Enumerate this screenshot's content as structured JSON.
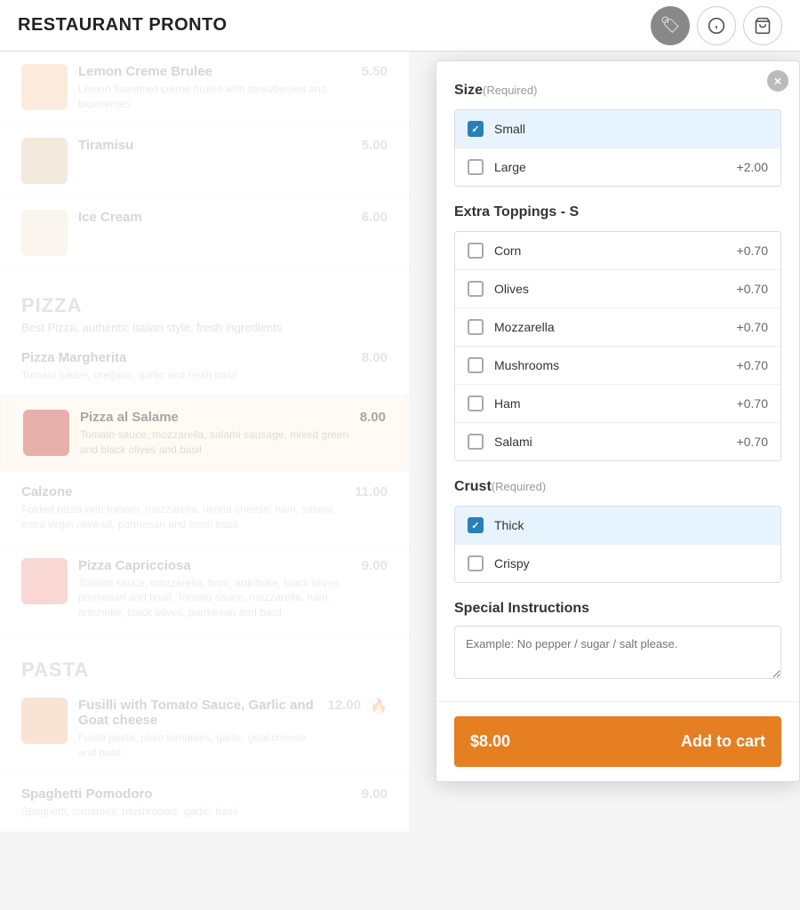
{
  "header": {
    "title": "RESTAURANT PRONTO",
    "icons": [
      {
        "name": "menu-icon",
        "label": "🏷",
        "active": true
      },
      {
        "name": "info-icon",
        "label": "ⓘ",
        "active": false
      },
      {
        "name": "cart-icon",
        "label": "🛒",
        "active": false
      }
    ]
  },
  "menu": {
    "sections": [
      {
        "id": "desserts",
        "title": "",
        "items": [
          {
            "id": "lemon-creme",
            "name": "Lemon Creme Brulee",
            "desc": "Lemon flavoured crème brulee with strawberries and blueberries",
            "price": "5.50",
            "hasImage": true,
            "imgColor": "#f4a460",
            "selected": false,
            "dimmed": true
          },
          {
            "id": "tiramisu",
            "name": "Tiramisu",
            "desc": "",
            "price": "5.00",
            "hasImage": true,
            "imgColor": "#c8a06a",
            "selected": false,
            "dimmed": true
          },
          {
            "id": "ice-cream",
            "name": "Ice Cream",
            "desc": "",
            "price": "6.00",
            "hasImage": true,
            "imgColor": "#e8d5b7",
            "selected": false,
            "dimmed": true
          }
        ]
      },
      {
        "id": "pizza",
        "title": "PIZZA",
        "desc": "Best Pizza, authentic Italian style, fresh ingredients",
        "items": [
          {
            "id": "pizza-margherita",
            "name": "Pizza Margherita",
            "desc": "Tomato sauce, oregano, garlic and fresh basil",
            "price": "8.00",
            "hasImage": false,
            "selected": false,
            "dimmed": true
          },
          {
            "id": "pizza-al-salame",
            "name": "Pizza al Salame",
            "desc": "Tomato sauce, mozzarella, salami sausage, mixed green and black olives and basil",
            "price": "8.00",
            "hasImage": true,
            "imgColor": "#c0392b",
            "selected": true,
            "dimmed": false
          },
          {
            "id": "calzone",
            "name": "Calzone",
            "desc": "Folded pizza with tomato, mozzarella, ricotta cheese, ham, salami, extra virgin olive oil, parmesan and fresh basil.",
            "price": "11.00",
            "hasImage": false,
            "selected": false,
            "dimmed": true
          },
          {
            "id": "pizza-capricciosa",
            "name": "Pizza Capricciosa",
            "desc": "Tomato sauce, mozzarella, ham, artichoke, black olives, parmesan and basil. Tomato sauce, mozzarella, ham, artichoke, black olives, parmesan and basil",
            "price": "9.00",
            "hasImage": true,
            "imgColor": "#e74c3c",
            "selected": false,
            "dimmed": true
          }
        ]
      },
      {
        "id": "pasta",
        "title": "PASTA",
        "desc": "",
        "items": [
          {
            "id": "fusilli",
            "name": "Fusilli with Tomato Sauce, Garlic and Goat cheese",
            "desc": "Fusilli pasta, plum tomatoes, garlic, goat cheese and basil",
            "price": "12.00",
            "hasImage": true,
            "imgColor": "#e08040",
            "hot": true,
            "selected": false,
            "dimmed": true
          },
          {
            "id": "spaghetti",
            "name": "Spaghetti Pomodoro",
            "desc": "Spaghetti, tomatoes, mushrooms, garlic, basil",
            "price": "9.00",
            "hasImage": false,
            "selected": false,
            "dimmed": true
          }
        ]
      }
    ]
  },
  "popup": {
    "close_label": "×",
    "sections": [
      {
        "id": "size",
        "label": "Size",
        "required": true,
        "type": "radio",
        "options": [
          {
            "id": "small",
            "label": "Small",
            "price": "",
            "selected": true
          },
          {
            "id": "large",
            "label": "Large",
            "price": "+2.00",
            "selected": false
          }
        ]
      },
      {
        "id": "extra-toppings",
        "label": "Extra Toppings - S",
        "required": false,
        "type": "checkbox",
        "options": [
          {
            "id": "corn",
            "label": "Corn",
            "price": "+0.70",
            "selected": false
          },
          {
            "id": "olives",
            "label": "Olives",
            "price": "+0.70",
            "selected": false
          },
          {
            "id": "mozzarella",
            "label": "Mozzarella",
            "price": "+0.70",
            "selected": false
          },
          {
            "id": "mushrooms",
            "label": "Mushrooms",
            "price": "+0.70",
            "selected": false
          },
          {
            "id": "ham",
            "label": "Ham",
            "price": "+0.70",
            "selected": false
          },
          {
            "id": "salami",
            "label": "Salami",
            "price": "+0.70",
            "selected": false
          }
        ]
      },
      {
        "id": "crust",
        "label": "Crust",
        "required": true,
        "type": "radio",
        "options": [
          {
            "id": "thick",
            "label": "Thick",
            "price": "",
            "selected": true
          },
          {
            "id": "crispy",
            "label": "Crispy",
            "price": "",
            "selected": false
          }
        ]
      }
    ],
    "special_instructions": {
      "label": "Special Instructions",
      "placeholder": "Example: No pepper / sugar / salt please."
    },
    "footer": {
      "price": "$8.00",
      "button_label": "Add to cart"
    }
  }
}
